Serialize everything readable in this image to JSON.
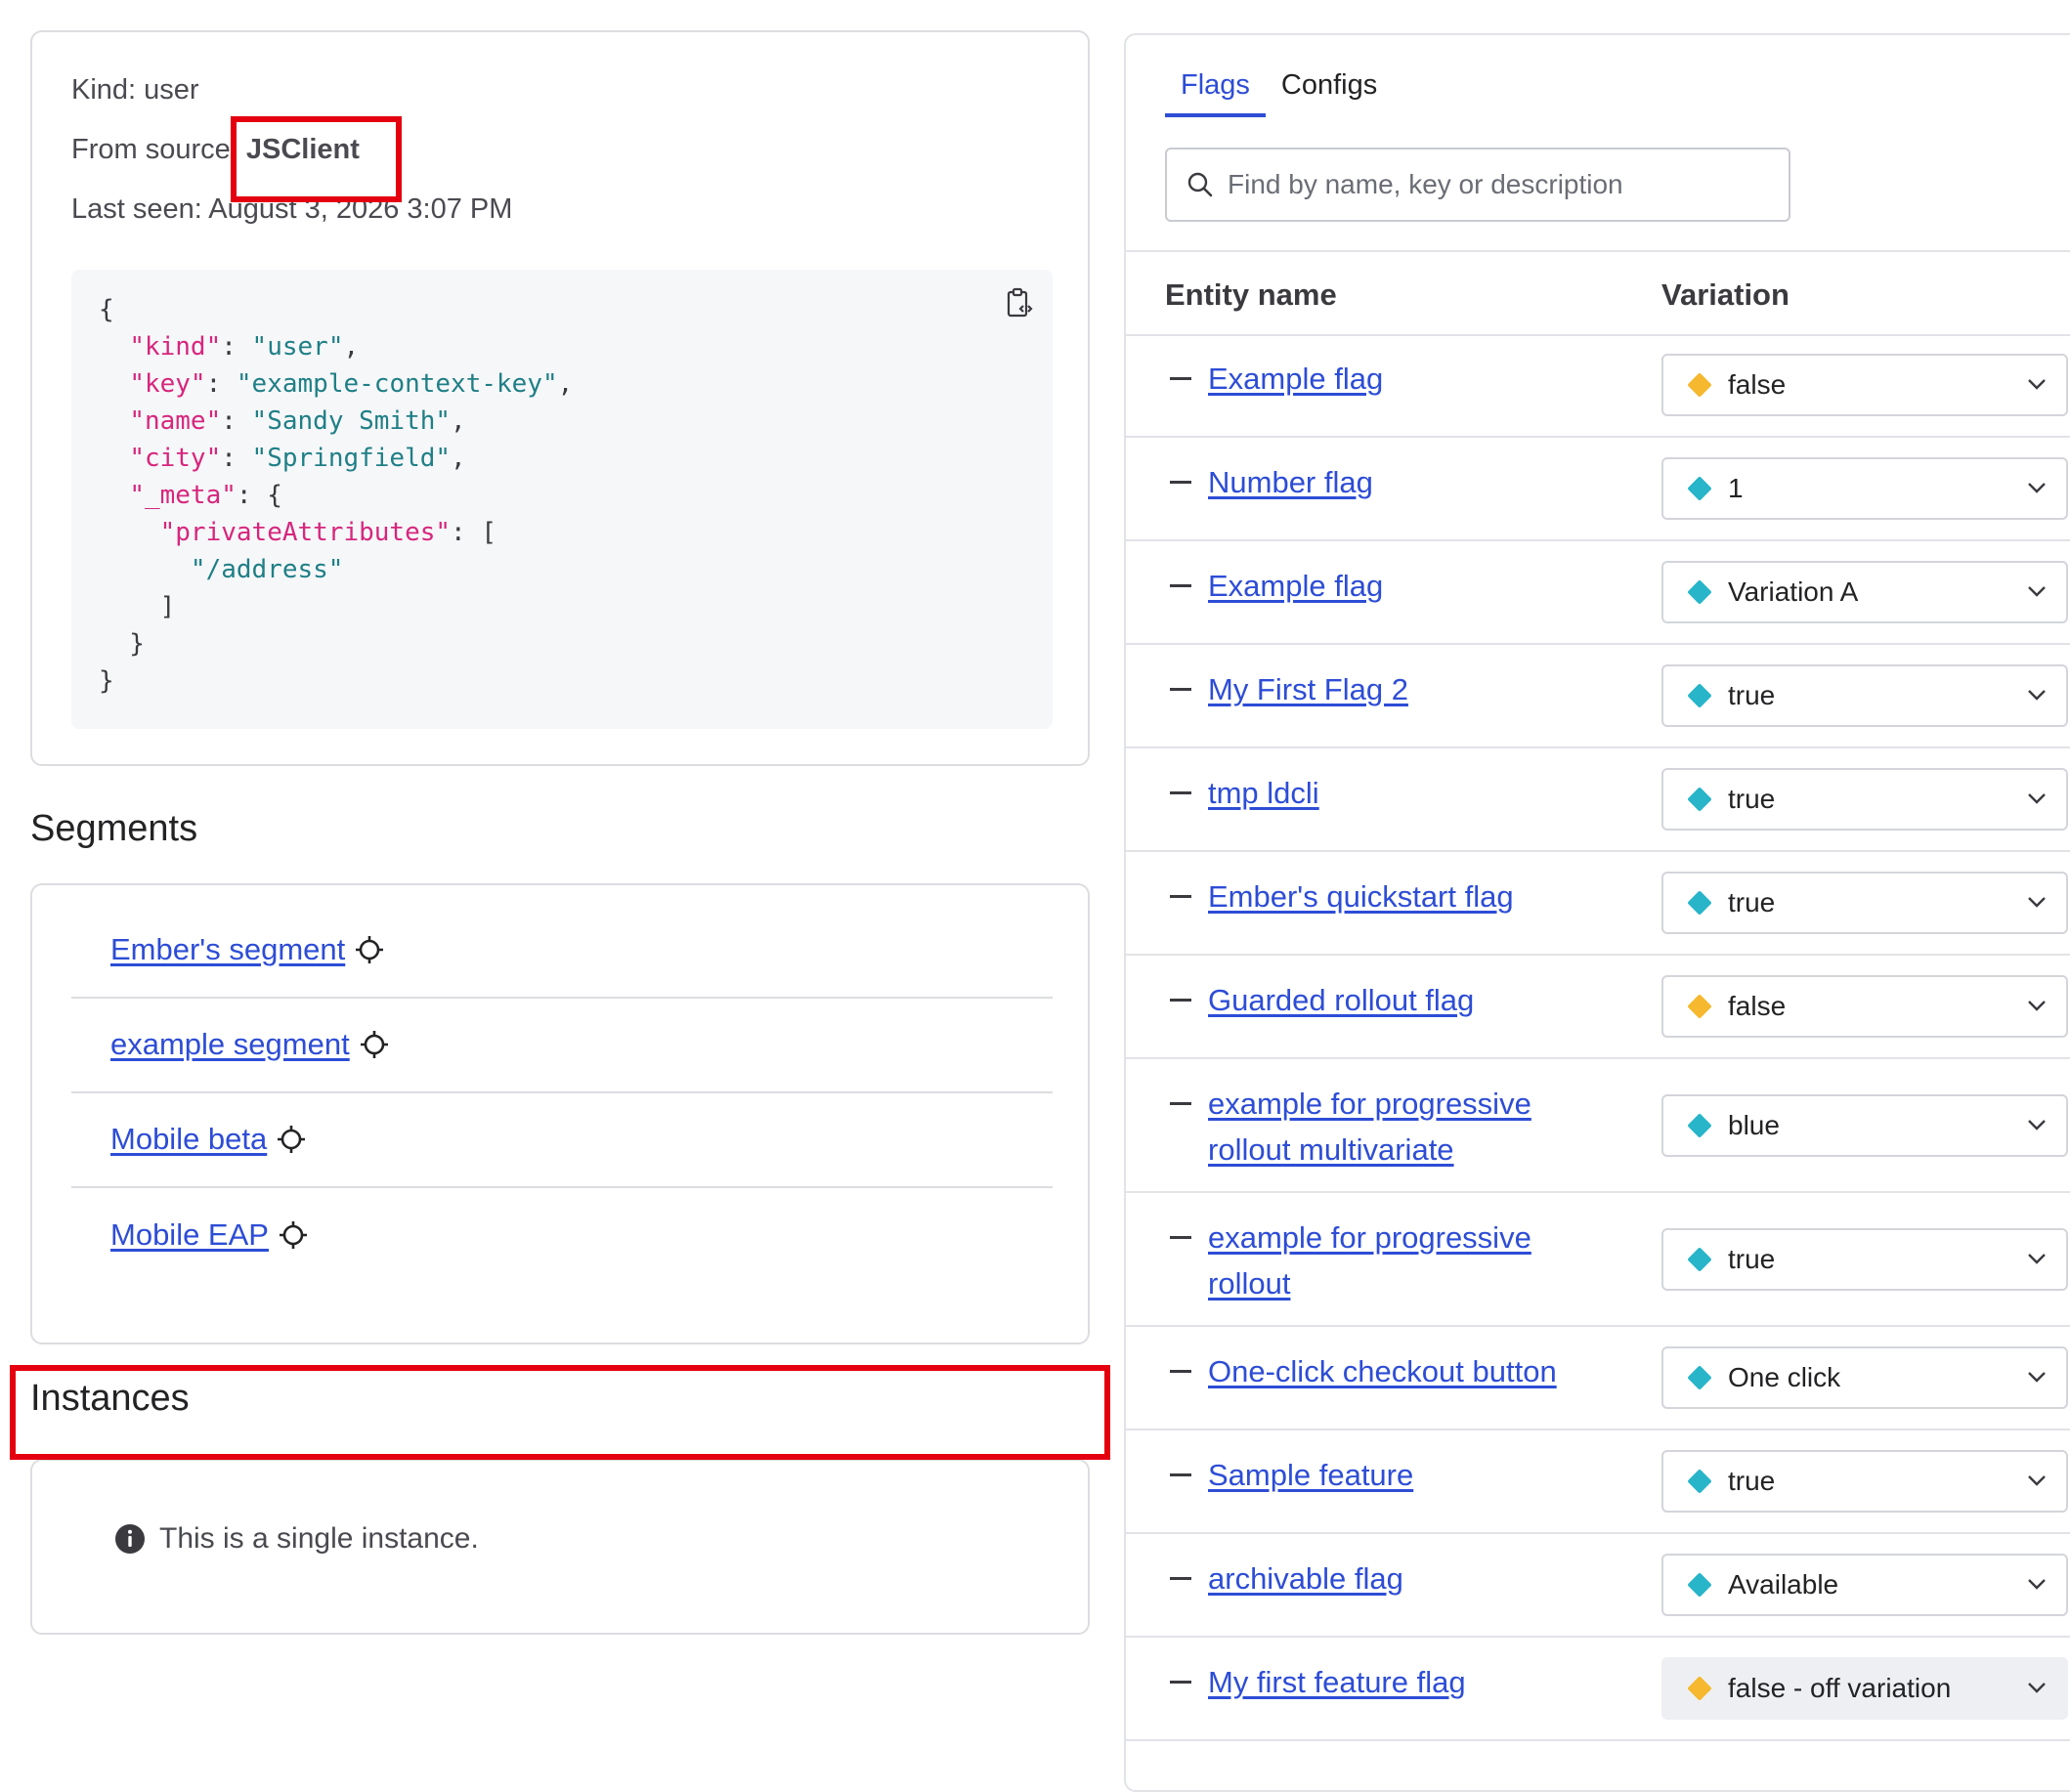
{
  "context": {
    "kind_text": "Kind: user",
    "source_prefix": "From source: ",
    "source_value": "JSClient",
    "last_seen_text": "Last seen: August 3, 2026 3:07 PM",
    "json_lines": [
      [
        {
          "t": "p",
          "v": "{"
        }
      ],
      [
        {
          "t": "p",
          "v": "  "
        },
        {
          "t": "k",
          "v": "\"kind\""
        },
        {
          "t": "p",
          "v": ": "
        },
        {
          "t": "s",
          "v": "\"user\""
        },
        {
          "t": "p",
          "v": ","
        }
      ],
      [
        {
          "t": "p",
          "v": "  "
        },
        {
          "t": "k",
          "v": "\"key\""
        },
        {
          "t": "p",
          "v": ": "
        },
        {
          "t": "s",
          "v": "\"example-context-key\""
        },
        {
          "t": "p",
          "v": ","
        }
      ],
      [
        {
          "t": "p",
          "v": "  "
        },
        {
          "t": "k",
          "v": "\"name\""
        },
        {
          "t": "p",
          "v": ": "
        },
        {
          "t": "s",
          "v": "\"Sandy Smith\""
        },
        {
          "t": "p",
          "v": ","
        }
      ],
      [
        {
          "t": "p",
          "v": "  "
        },
        {
          "t": "k",
          "v": "\"city\""
        },
        {
          "t": "p",
          "v": ": "
        },
        {
          "t": "s",
          "v": "\"Springfield\""
        },
        {
          "t": "p",
          "v": ","
        }
      ],
      [
        {
          "t": "p",
          "v": "  "
        },
        {
          "t": "k",
          "v": "\"_meta\""
        },
        {
          "t": "p",
          "v": ": {"
        }
      ],
      [
        {
          "t": "p",
          "v": "    "
        },
        {
          "t": "k",
          "v": "\"privateAttributes\""
        },
        {
          "t": "p",
          "v": ": ["
        }
      ],
      [
        {
          "t": "p",
          "v": "      "
        },
        {
          "t": "s",
          "v": "\"/address\""
        }
      ],
      [
        {
          "t": "p",
          "v": "    ]"
        }
      ],
      [
        {
          "t": "p",
          "v": "  }"
        }
      ],
      [
        {
          "t": "p",
          "v": "}"
        }
      ]
    ]
  },
  "segments": {
    "title": "Segments",
    "items": [
      "Ember's segment",
      "example segment",
      "Mobile beta",
      "Mobile EAP"
    ]
  },
  "instances": {
    "title": "Instances",
    "info_text": "This is a single instance."
  },
  "flags_panel": {
    "tabs": [
      {
        "label": "Flags",
        "active": true
      },
      {
        "label": "Configs",
        "active": false
      }
    ],
    "search_placeholder": "Find by name, key or description",
    "col_entity": "Entity name",
    "col_variation": "Variation",
    "colors": {
      "false_dot": "#f5b82e",
      "true_dot": "#28b5c9",
      "link": "#2d4dd6"
    },
    "flags": [
      {
        "name": "Example flag",
        "variation": "false",
        "dot": "yellow"
      },
      {
        "name": "Number flag",
        "variation": "1",
        "dot": "teal"
      },
      {
        "name": "Example flag",
        "variation": "Variation A",
        "dot": "teal"
      },
      {
        "name": "My First Flag 2",
        "variation": "true",
        "dot": "teal"
      },
      {
        "name": "tmp ldcli",
        "variation": "true",
        "dot": "teal"
      },
      {
        "name": "Ember's quickstart flag",
        "variation": "true",
        "dot": "teal"
      },
      {
        "name": "Guarded rollout flag",
        "variation": "false",
        "dot": "yellow"
      },
      {
        "name": "example for progressive rollout multivariate",
        "variation": "blue",
        "dot": "teal"
      },
      {
        "name": "example for progressive rollout",
        "variation": "true",
        "dot": "teal"
      },
      {
        "name": "One-click checkout button",
        "variation": "One click",
        "dot": "teal"
      },
      {
        "name": "Sample feature",
        "variation": "true",
        "dot": "teal"
      },
      {
        "name": "archivable flag",
        "variation": "Available",
        "dot": "teal"
      },
      {
        "name": "My first feature flag",
        "variation": "false - off variation",
        "dot": "yellow",
        "disabled": true
      }
    ]
  }
}
